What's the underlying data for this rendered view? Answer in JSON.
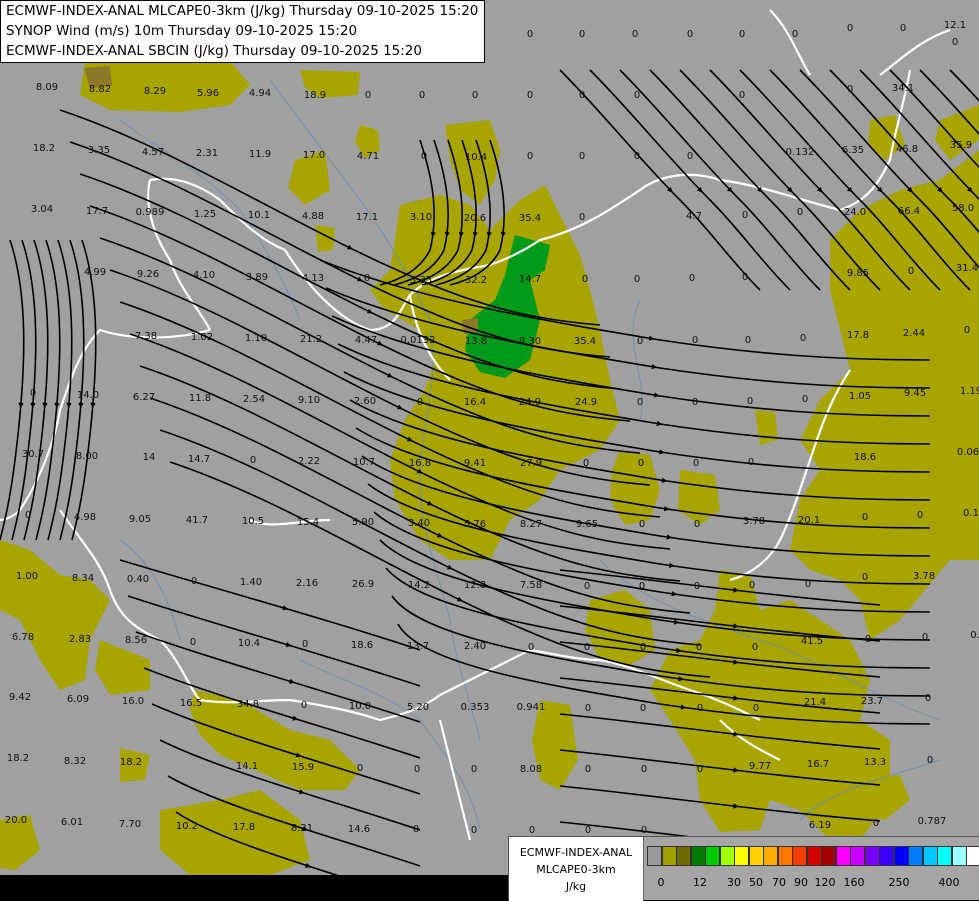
{
  "title_lines": [
    "ECMWF-INDEX-ANAL MLCAPE0-3km (J/kg) Thursday 09-10-2025 15:20",
    "SYNOP Wind (m/s) 10m Thursday 09-10-2025 15:20",
    "ECMWF-INDEX-ANAL SBCIN (J/kg) Thursday 09-10-2025 15:20"
  ],
  "legend": {
    "name_line1": "ECMWF-INDEX-ANAL",
    "name_line2": "MLCAPE0-3km",
    "unit": "J/kg",
    "colors": [
      "#999999",
      "#a0a000",
      "#6e6e00",
      "#007a00",
      "#00c800",
      "#a0ff00",
      "#ffff00",
      "#ffd200",
      "#ffaa00",
      "#ff7800",
      "#ff3c00",
      "#d20000",
      "#a00000",
      "#ff00ff",
      "#c800ff",
      "#7800ff",
      "#3c00ff",
      "#0000ff",
      "#0078ff",
      "#00c8ff",
      "#00ffff",
      "#a0ffff",
      "#ffffff"
    ],
    "ticks": [
      "0",
      "12",
      "30",
      "50",
      "70",
      "90",
      "120",
      "160",
      "250",
      "400"
    ]
  },
  "colors": {
    "background": "#a0a0a0",
    "cape_low": "#a8a400",
    "cape_mid": "#00a020",
    "border": "#ffffff",
    "river": "#6a8fb0",
    "streamline": "#000000"
  },
  "values": [
    [
      "12.1"
    ],
    [
      "0"
    ],
    [
      "0"
    ],
    [
      "0"
    ],
    [
      "0"
    ],
    [
      "0"
    ],
    [
      "0"
    ],
    [
      "0"
    ],
    [
      "0"
    ],
    [
      "0"
    ],
    [
      "8.09"
    ],
    [
      "8.82"
    ],
    [
      "8.29"
    ],
    [
      "5.96"
    ],
    [
      "4.94"
    ],
    [
      "18.9"
    ],
    [
      "0"
    ],
    [
      "0"
    ],
    [
      "0"
    ],
    [
      "0"
    ],
    [
      "0"
    ],
    [
      "0"
    ],
    [
      "0"
    ],
    [
      "0"
    ],
    [
      "34.1"
    ],
    [
      "18.2"
    ],
    [
      "3.35"
    ],
    [
      "4.57"
    ],
    [
      "2.31"
    ],
    [
      "11.9"
    ],
    [
      "17.0"
    ],
    [
      "4.71"
    ],
    [
      "0"
    ],
    [
      "10.4"
    ],
    [
      "0"
    ],
    [
      "0"
    ],
    [
      "0"
    ],
    [
      "0"
    ],
    [
      "0.132"
    ],
    [
      "6.35"
    ],
    [
      "46.8"
    ],
    [
      "35.9"
    ],
    [
      "3.04"
    ],
    [
      "17.7"
    ],
    [
      "0.989"
    ],
    [
      "1.25"
    ],
    [
      "10.1"
    ],
    [
      "4.88"
    ],
    [
      "17.1"
    ],
    [
      "3.10"
    ],
    [
      "20.6"
    ],
    [
      "35.4"
    ],
    [
      "0"
    ],
    [
      "4.7"
    ],
    [
      "0"
    ],
    [
      "0"
    ],
    [
      "24.0"
    ],
    [
      "66.4"
    ],
    [
      "58.0"
    ],
    [
      "4.99"
    ],
    [
      "9.26"
    ],
    [
      "4.10"
    ],
    [
      "3.89"
    ],
    [
      "4.13"
    ],
    [
      "0"
    ],
    [
      "3.35"
    ],
    [
      "32.2"
    ],
    [
      "14.7"
    ],
    [
      "0"
    ],
    [
      "0"
    ],
    [
      "0"
    ],
    [
      "0"
    ],
    [
      "9.85"
    ],
    [
      "0"
    ],
    [
      "31.4"
    ],
    [
      "7.38"
    ],
    [
      "1.02"
    ],
    [
      "1.10"
    ],
    [
      "21.2"
    ],
    [
      "4.47"
    ],
    [
      "0.0132"
    ],
    [
      "13.8"
    ],
    [
      "9.30"
    ],
    [
      "35.4"
    ],
    [
      "0"
    ],
    [
      "0"
    ],
    [
      "0"
    ],
    [
      "0"
    ],
    [
      "17.8"
    ],
    [
      "2.44"
    ],
    [
      "0"
    ],
    [
      "0"
    ],
    [
      "14.0"
    ],
    [
      "6.27"
    ],
    [
      "11.8"
    ],
    [
      "2.54"
    ],
    [
      "9.10"
    ],
    [
      "2.60"
    ],
    [
      "0"
    ],
    [
      "16.4"
    ],
    [
      "24.9"
    ],
    [
      "24.9"
    ],
    [
      "0"
    ],
    [
      "0"
    ],
    [
      "0"
    ],
    [
      "0"
    ],
    [
      "1.05"
    ],
    [
      "9.45"
    ],
    [
      "1.19"
    ],
    [
      "30.7"
    ],
    [
      "8.00"
    ],
    [
      "14"
    ],
    [
      "14.7"
    ],
    [
      "0"
    ],
    [
      "2.22"
    ],
    [
      "10.7"
    ],
    [
      "16.8"
    ],
    [
      "9.41"
    ],
    [
      "27.9"
    ],
    [
      "0"
    ],
    [
      "0"
    ],
    [
      "0"
    ],
    [
      "0"
    ],
    [
      "18.6"
    ],
    [
      "0.06"
    ],
    [
      "0"
    ],
    [
      "4.98"
    ],
    [
      "9.05"
    ],
    [
      "41.7"
    ],
    [
      "10.5"
    ],
    [
      "15.4"
    ],
    [
      "5.90"
    ],
    [
      "3.40"
    ],
    [
      "5.76"
    ],
    [
      "8.27"
    ],
    [
      "9.65"
    ],
    [
      "0"
    ],
    [
      "0"
    ],
    [
      "3.78"
    ],
    [
      "20.1"
    ],
    [
      "0"
    ],
    [
      "0"
    ],
    [
      "0.1"
    ],
    [
      "1.00"
    ],
    [
      "8.34"
    ],
    [
      "0.40"
    ],
    [
      "0"
    ],
    [
      "1.40"
    ],
    [
      "2.16"
    ],
    [
      "26.9"
    ],
    [
      "14.2"
    ],
    [
      "12.8"
    ],
    [
      "7.58"
    ],
    [
      "0"
    ],
    [
      "0"
    ],
    [
      "0"
    ],
    [
      "0"
    ],
    [
      "0"
    ],
    [
      "0"
    ],
    [
      "3.78"
    ],
    [
      "6.78"
    ],
    [
      "2.83"
    ],
    [
      "8.56"
    ],
    [
      "0"
    ],
    [
      "10.4"
    ],
    [
      "0"
    ],
    [
      "18.6"
    ],
    [
      "13.7"
    ],
    [
      "2.40"
    ],
    [
      "0"
    ],
    [
      "0"
    ],
    [
      "0"
    ],
    [
      "0"
    ],
    [
      "0"
    ],
    [
      "41.5"
    ],
    [
      "0"
    ],
    [
      "0"
    ],
    [
      "0."
    ],
    [
      "9.42"
    ],
    [
      "6.09"
    ],
    [
      "16.0"
    ],
    [
      "16.5"
    ],
    [
      "34.8"
    ],
    [
      "0"
    ],
    [
      "10.0"
    ],
    [
      "5.20"
    ],
    [
      "0.353"
    ],
    [
      "0.941"
    ],
    [
      "0"
    ],
    [
      "0"
    ],
    [
      "0"
    ],
    [
      "0"
    ],
    [
      "21.4"
    ],
    [
      "23.7"
    ],
    [
      "0"
    ],
    [
      "18.2"
    ],
    [
      "8.32"
    ],
    [
      "18.2"
    ],
    [
      "14.1"
    ],
    [
      "15.9"
    ],
    [
      "0"
    ],
    [
      "0"
    ],
    [
      "0"
    ],
    [
      "8.08"
    ],
    [
      "0"
    ],
    [
      "0"
    ],
    [
      "0"
    ],
    [
      "9.77"
    ],
    [
      "16.7"
    ],
    [
      "13.3"
    ],
    [
      "0"
    ],
    [
      "20.0"
    ],
    [
      "6.01"
    ],
    [
      "7.70"
    ],
    [
      "10.2"
    ],
    [
      "17.8"
    ],
    [
      "8.21"
    ],
    [
      "14.6"
    ],
    [
      "0"
    ],
    [
      "0"
    ],
    [
      "0"
    ],
    [
      "0"
    ],
    [
      "0"
    ],
    [
      "6.19"
    ],
    [
      "0"
    ],
    [
      "0.787"
    ]
  ]
}
